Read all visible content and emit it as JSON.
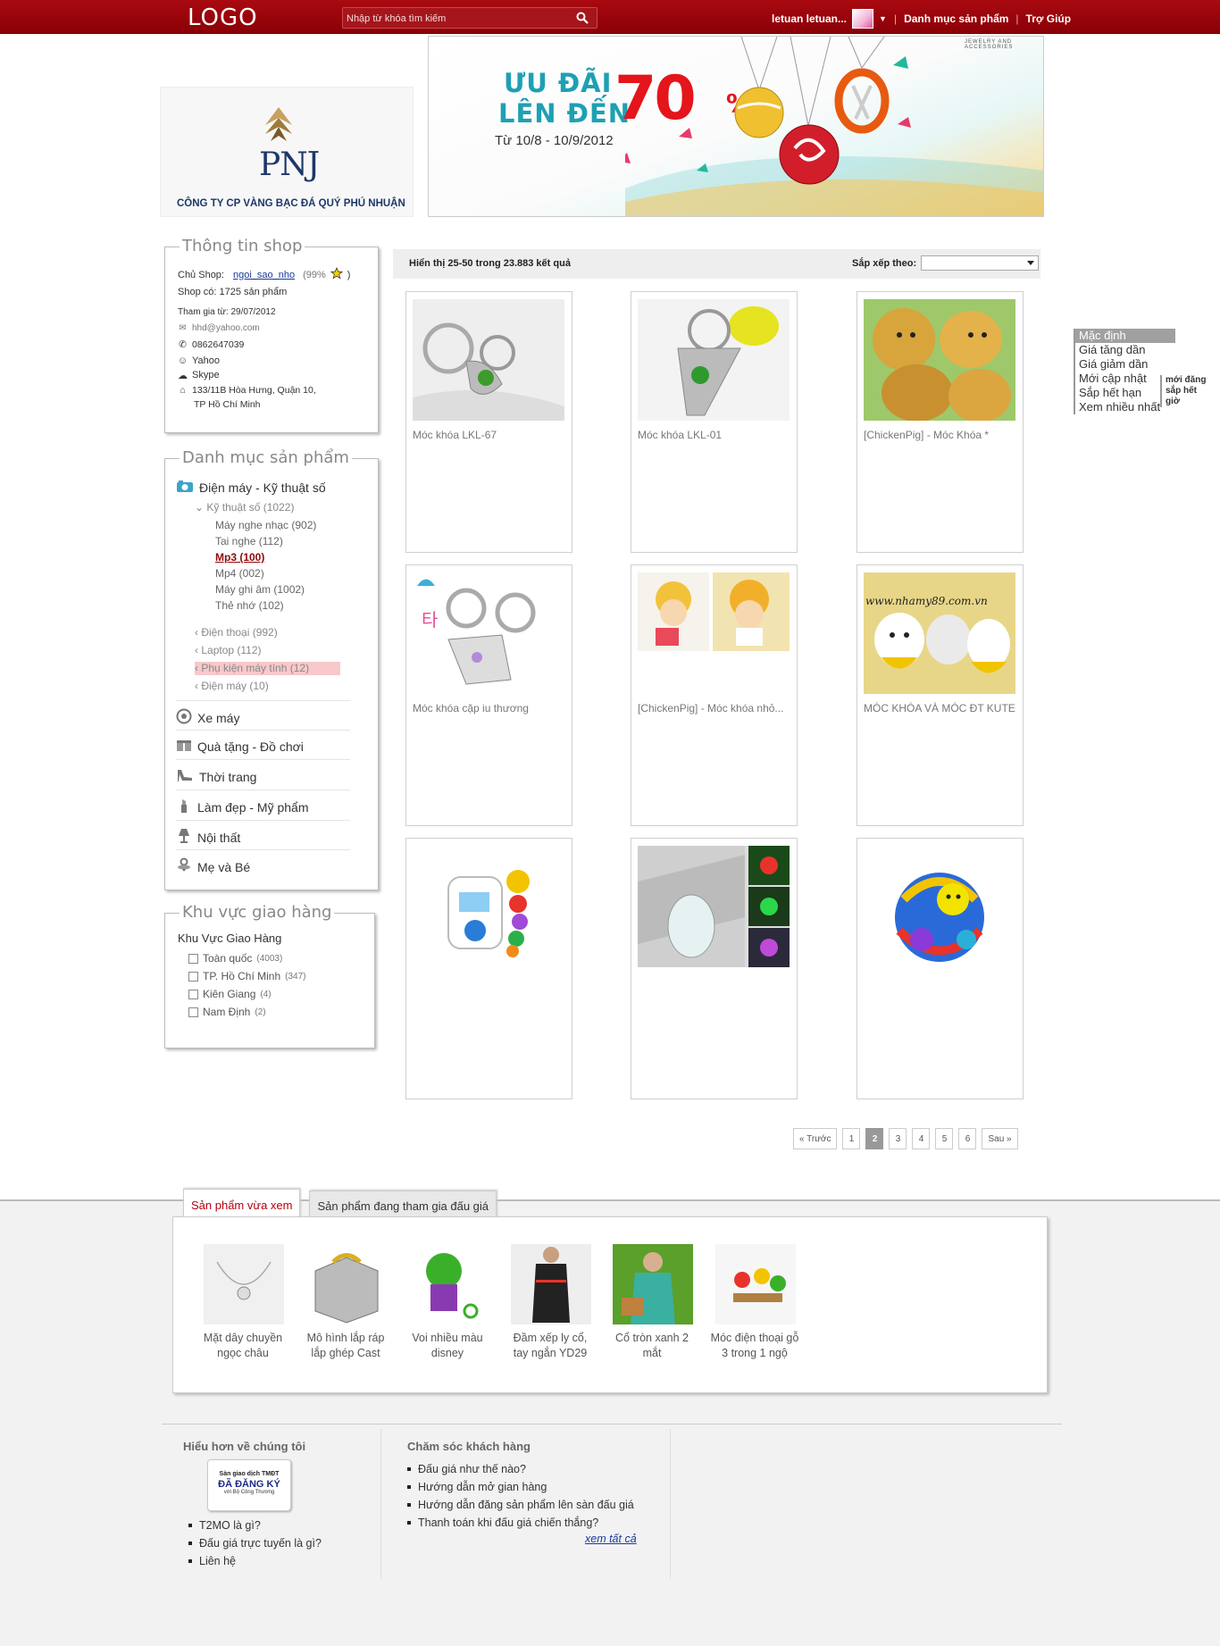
{
  "header": {
    "logo": "LOGO",
    "search_placeholder": "Nhập từ khóa tìm kiếm",
    "user": "letuan letuan...",
    "nav_categories": "Danh mục sản phẩm",
    "nav_help": "Trợ Giúp"
  },
  "shop_banner": {
    "brand": "PNJ",
    "company": "CÔNG TY CP VÀNG BẠC ĐÁ QUÝ PHÚ NHUẬN",
    "promo_line1": "ƯU ĐÃI",
    "promo_line2": "LÊN ĐẾN",
    "promo_value": "70",
    "promo_unit": "%",
    "promo_dates": "Từ 10/8 - 10/9/2012",
    "promo_tag": "JEWELRY AND ACCESSORIES"
  },
  "shop_info": {
    "title": "Thông tin shop",
    "owner_label": "Chủ Shop:",
    "owner_name": "ngoi_sao_nho",
    "rating": "(99%",
    "rating_close": ")",
    "product_count": "Shop có: 1725 sản phẩm",
    "joined": "Tham gia từ: 29/07/2012",
    "email": "hhd@yahoo.com",
    "phone": "0862647039",
    "yahoo": "Yahoo",
    "skype": "Skype",
    "address_line1": "133/11B Hòa Hưng, Quận 10,",
    "address_line2": "TP Hồ Chí Minh"
  },
  "categories": {
    "title": "Danh mục sản phẩm",
    "main": [
      {
        "label": "Điện máy - Kỹ thuật số",
        "icon": "camera-icon"
      },
      {
        "label": "Xe máy",
        "icon": "wheel-icon"
      },
      {
        "label": "Quà tặng - Đồ chơi",
        "icon": "gift-icon"
      },
      {
        "label": "Thời trang",
        "icon": "heel-icon"
      },
      {
        "label": "Làm đẹp - Mỹ phẩm",
        "icon": "lipstick-icon"
      },
      {
        "label": "Nội thất",
        "icon": "lamp-icon"
      },
      {
        "label": "Mẹ và Bé",
        "icon": "pacifier-icon"
      }
    ],
    "sub_group": "Kỹ thuật số (1022)",
    "sub_items": [
      "Máy nghe nhạc (902)",
      "Tai nghe (112)",
      "Mp3 (100)",
      "Mp4 (002)",
      "Máy ghi âm (1002)",
      "Thẻ nhớ (102)"
    ],
    "siblings": [
      "Điện thoại (992)",
      "Laptop (112)",
      "Phụ kiện máy tính (12)",
      "Điện máy (10)"
    ]
  },
  "delivery": {
    "title": "Khu vực giao hàng",
    "heading": "Khu Vực Giao Hàng",
    "areas": [
      {
        "name": "Toàn quốc",
        "count": "(4003)"
      },
      {
        "name": "TP. Hồ Chí Minh",
        "count": "(347)"
      },
      {
        "name": "Kiên Giang",
        "count": "(4)"
      },
      {
        "name": "Nam Định",
        "count": "(2)"
      }
    ]
  },
  "results": {
    "summary": "Hiển thị 25-50 trong 23.883 kết quả",
    "sort_label": "Sắp xếp theo:",
    "sort_options": [
      "Mặc định",
      "Giá tăng dần",
      "Giá giảm dần",
      "Mới cập nhật",
      "Sắp hết hạn",
      "Xem nhiều nhất"
    ],
    "sort_extra": [
      "mới đăng",
      "sắp hết giờ"
    ]
  },
  "products": [
    {
      "name": "Móc khóa LKL-67"
    },
    {
      "name": "Móc khóa LKL-01"
    },
    {
      "name": "[ChickenPig] - Móc Khóa *"
    },
    {
      "name": "Móc khóa cặp iu thương"
    },
    {
      "name": "[ChickenPig] - Móc khóa nhỏ..."
    },
    {
      "name": "MÓC KHÓA VÀ MÓC ĐT KUTE"
    },
    {
      "name": ""
    },
    {
      "name": ""
    },
    {
      "name": ""
    }
  ],
  "watermark": "www.nhamy89.com.vn",
  "pager": {
    "prev": "« Trước",
    "pages": [
      "1",
      "2",
      "3",
      "4",
      "5",
      "6"
    ],
    "current": "2",
    "next": "Sau »"
  },
  "tabs": {
    "recent": "Sản phẩm vừa xem",
    "bidding": "Sản phẩm đang tham gia đấu giá"
  },
  "recent": [
    {
      "line1": "Mặt dây chuyền",
      "line2": "ngọc châu"
    },
    {
      "line1": "Mô hình lắp ráp",
      "line2": "lắp ghép Cast"
    },
    {
      "line1": "Voi nhiều màu",
      "line2": "disney"
    },
    {
      "line1": "Đầm xếp ly cổ,",
      "line2": "tay ngắn YD29"
    },
    {
      "line1": "Cổ tròn xanh 2",
      "line2": "mắt"
    },
    {
      "line1": "Móc điện thoại gỗ",
      "line2": "3 trong 1 ngộ"
    }
  ],
  "footer": {
    "about_title": "Hiểu hơn về chúng tôi",
    "badge_l1": "Sàn giao dịch TMĐT",
    "badge_l2": "ĐÃ ĐĂNG KÝ",
    "badge_l3": "với Bộ Công Thương",
    "about_links": [
      "T2MO là gì?",
      "Đấu giá trực tuyến là gì?",
      "Liên hệ"
    ],
    "care_title": "Chăm sóc khách hàng",
    "care_links": [
      "Đấu giá như thế nào?",
      "Hướng dẫn mở gian hàng",
      "Hướng dẫn đăng sản phẩm lên sàn đấu giá",
      "Thanh toán khi đấu giá chiến thắng?"
    ],
    "see_all": "xem tất cả"
  },
  "colors": {
    "brand": "#a00a0f",
    "highlight": "#f7c9cb",
    "link": "#1a3a9a"
  }
}
